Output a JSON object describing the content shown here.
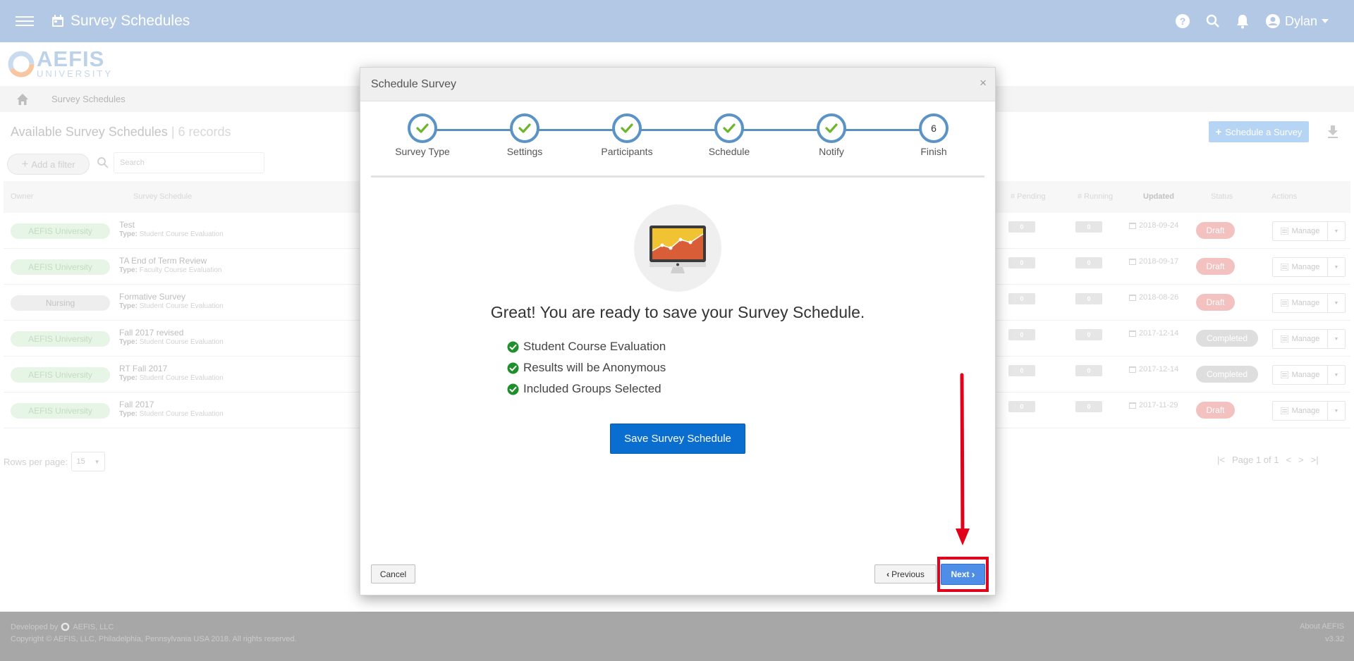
{
  "topbar": {
    "title": "Survey Schedules",
    "user_name": "Dylan"
  },
  "logo": {
    "name": "AEFIS",
    "subtitle": "UNIVERSITY"
  },
  "breadcrumb": {
    "current": "Survey Schedules"
  },
  "page": {
    "heading": "Available Survey Schedules",
    "record_count": "| 6 records",
    "schedule_button": "Schedule a Survey",
    "add_filter": "Add a filter",
    "search_placeholder": "Search"
  },
  "table": {
    "columns": {
      "owner": "Owner",
      "schedule": "Survey Schedule",
      "pending": "# Pending",
      "running": "# Running",
      "updated": "Updated",
      "status": "Status",
      "actions": "Actions"
    },
    "type_prefix": "Type:",
    "manage_label": "Manage",
    "rows": [
      {
        "owner": "AEFIS University",
        "owner_style": "green",
        "name": "Test",
        "type": "Student Course Evaluation",
        "pending": "0",
        "running": "0",
        "updated": "2018-09-24",
        "status": "Draft",
        "status_style": "draft"
      },
      {
        "owner": "AEFIS University",
        "owner_style": "green",
        "name": "TA End of Term Review",
        "type": "Faculty Course Evaluation",
        "pending": "0",
        "running": "0",
        "updated": "2018-09-17",
        "status": "Draft",
        "status_style": "draft"
      },
      {
        "owner": "Nursing",
        "owner_style": "grey",
        "name": "Formative Survey",
        "type": "Student Course Evaluation",
        "pending": "0",
        "running": "0",
        "updated": "2018-08-26",
        "status": "Draft",
        "status_style": "draft"
      },
      {
        "owner": "AEFIS University",
        "owner_style": "green",
        "name": "Fall 2017 revised",
        "type": "Student Course Evaluation",
        "pending": "0",
        "running": "0",
        "updated": "2017-12-14",
        "status": "Completed",
        "status_style": "completed"
      },
      {
        "owner": "AEFIS University",
        "owner_style": "green",
        "name": "RT Fall 2017",
        "type": "Student Course Evaluation",
        "pending": "0",
        "running": "0",
        "updated": "2017-12-14",
        "status": "Completed",
        "status_style": "completed"
      },
      {
        "owner": "AEFIS University",
        "owner_style": "green",
        "name": "Fall 2017",
        "type": "Student Course Evaluation",
        "pending": "0",
        "running": "0",
        "updated": "2017-11-29",
        "status": "Draft",
        "status_style": "draft"
      }
    ],
    "rows_per_page_label": "Rows per page:",
    "rows_per_page_value": "15",
    "page_label": "Page 1 of 1"
  },
  "footer": {
    "developed_by": "Developed by",
    "company": "AEFIS, LLC",
    "copyright": "Copyright © AEFIS, LLC, Philadelphia, Pennsylvania USA 2018. All rights reserved.",
    "about": "About AEFIS",
    "version": "v3.32"
  },
  "modal": {
    "title": "Schedule Survey",
    "close": "×",
    "steps": [
      {
        "label": "Survey Type",
        "state": "done"
      },
      {
        "label": "Settings",
        "state": "done"
      },
      {
        "label": "Participants",
        "state": "done"
      },
      {
        "label": "Schedule",
        "state": "done"
      },
      {
        "label": "Notify",
        "state": "done"
      },
      {
        "label": "Finish",
        "state": "current",
        "number": "6"
      }
    ],
    "finish_title": "Great! You are ready to save your Survey Schedule.",
    "summary": [
      "Student Course Evaluation",
      "Results will be Anonymous",
      "Included Groups Selected"
    ],
    "save_button": "Save Survey Schedule",
    "cancel_button": "Cancel",
    "previous_button": "Previous",
    "next_button": "Next"
  },
  "colors": {
    "topbar": "#b3c8e4",
    "primary": "#0a6ed1",
    "step_ring": "#5b93c6",
    "check": "#6fb52c",
    "highlight": "#e0021b"
  },
  "icons": {
    "menu": "hamburger-icon",
    "calendar": "calendar-icon",
    "help": "help-icon",
    "search": "search-icon",
    "bell": "bell-icon",
    "user": "user-icon",
    "home": "home-icon",
    "download": "download-icon",
    "check": "check-icon",
    "monitor": "monitor-chart-icon"
  }
}
